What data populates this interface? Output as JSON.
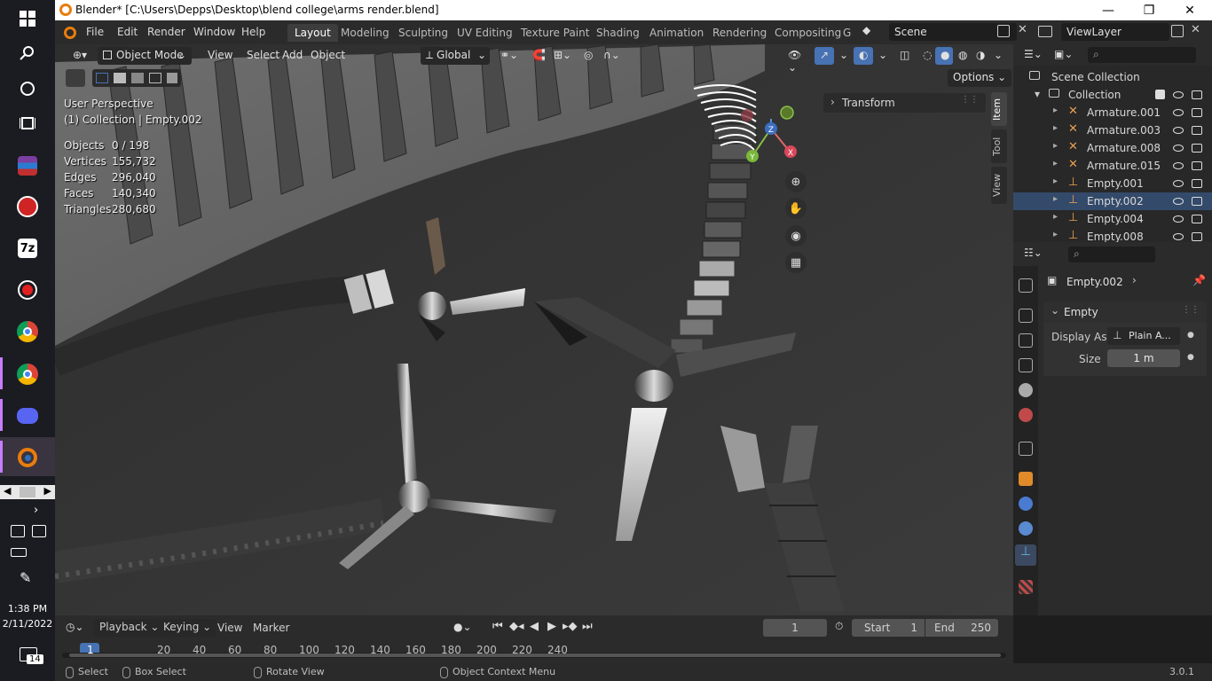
{
  "window": {
    "title": "Blender* [C:\\Users\\Depps\\Desktop\\blend college\\arms render.blend]",
    "minimize": "—",
    "restore": "❐",
    "close": "✕"
  },
  "taskbar": {
    "time": "1:38 PM",
    "date": "2/11/2022",
    "notifications": "14",
    "icons": [
      "windows-icon",
      "search-icon",
      "cortana-icon",
      "task-view-icon",
      "winrar-icon",
      "app-red-icon",
      "7zip-icon",
      "recorder-icon",
      "chrome-icon",
      "chrome-profile-icon",
      "discord-icon",
      "blender-icon"
    ],
    "app_label_7z": "7z"
  },
  "menus": {
    "file": "File",
    "edit": "Edit",
    "render": "Render",
    "window": "Window",
    "help": "Help"
  },
  "workspaces": [
    "Layout",
    "Modeling",
    "Sculpting",
    "UV Editing",
    "Texture Paint",
    "Shading",
    "Animation",
    "Rendering",
    "Compositing",
    "G"
  ],
  "scene": {
    "name": "Scene",
    "view_layer": "ViewLayer"
  },
  "viewport_header": {
    "mode": "Object Mode",
    "view": "View",
    "select": "Select",
    "add": "Add",
    "object": "Object",
    "orientation": "Global",
    "options": "Options"
  },
  "viewport_overlay": {
    "perspective": "User Perspective",
    "context": "(1) Collection | Empty.002",
    "stats": [
      {
        "label": "Objects",
        "value": "0 / 198"
      },
      {
        "label": "Vertices",
        "value": "155,732"
      },
      {
        "label": "Edges",
        "value": "296,040"
      },
      {
        "label": "Faces",
        "value": "140,340"
      },
      {
        "label": "Triangles",
        "value": "280,680"
      }
    ]
  },
  "gizmo": {
    "x": "X",
    "y": "Y",
    "z": "Z"
  },
  "sidebar": {
    "panel": "Transform",
    "tabs": [
      "Item",
      "Tool",
      "View"
    ]
  },
  "outliner": {
    "root": "Scene Collection",
    "collection": "Collection",
    "items": [
      "Armature.001",
      "Armature.003",
      "Armature.008",
      "Armature.015",
      "Empty.001",
      "Empty.002",
      "Empty.004",
      "Empty.008"
    ],
    "selected_index": 5
  },
  "properties": {
    "object_name": "Empty.002",
    "section": "Empty",
    "display_as_label": "Display As",
    "display_as_value": "Plain A...",
    "size_label": "Size",
    "size_value": "1 m"
  },
  "timeline": {
    "playback": "Playback",
    "keying": "Keying",
    "view": "View",
    "marker": "Marker",
    "current_frame": "1",
    "start_label": "Start",
    "start_value": "1",
    "end_label": "End",
    "end_value": "250",
    "ruler": [
      "1",
      "20",
      "40",
      "60",
      "80",
      "100",
      "120",
      "140",
      "160",
      "180",
      "200",
      "220",
      "240"
    ]
  },
  "statusbar": {
    "select": "Select",
    "box_select": "Box Select",
    "rotate_view": "Rotate View",
    "context_menu": "Object Context Menu",
    "version": "3.0.1"
  },
  "colors": {
    "accent": "#4772b3",
    "blender_orange": "#e87d0d",
    "selection": "#334a6a"
  }
}
